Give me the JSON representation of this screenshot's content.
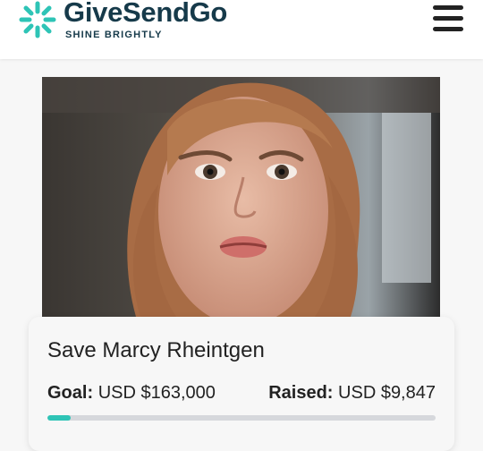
{
  "brand": {
    "name": "GiveSendGo",
    "tagline": "SHINE BRIGHTLY",
    "logo_icon": "starburst-icon",
    "colors": {
      "teal": "#2ec4b6",
      "navy": "#163a4a"
    }
  },
  "header": {
    "menu_icon": "hamburger-menu-icon"
  },
  "campaign": {
    "title": "Save Marcy Rheintgen",
    "goal_label": "Goal:",
    "goal_value": "USD $163,000",
    "raised_label": "Raised:",
    "raised_value": "USD $9,847",
    "progress_fraction": 0.06
  }
}
